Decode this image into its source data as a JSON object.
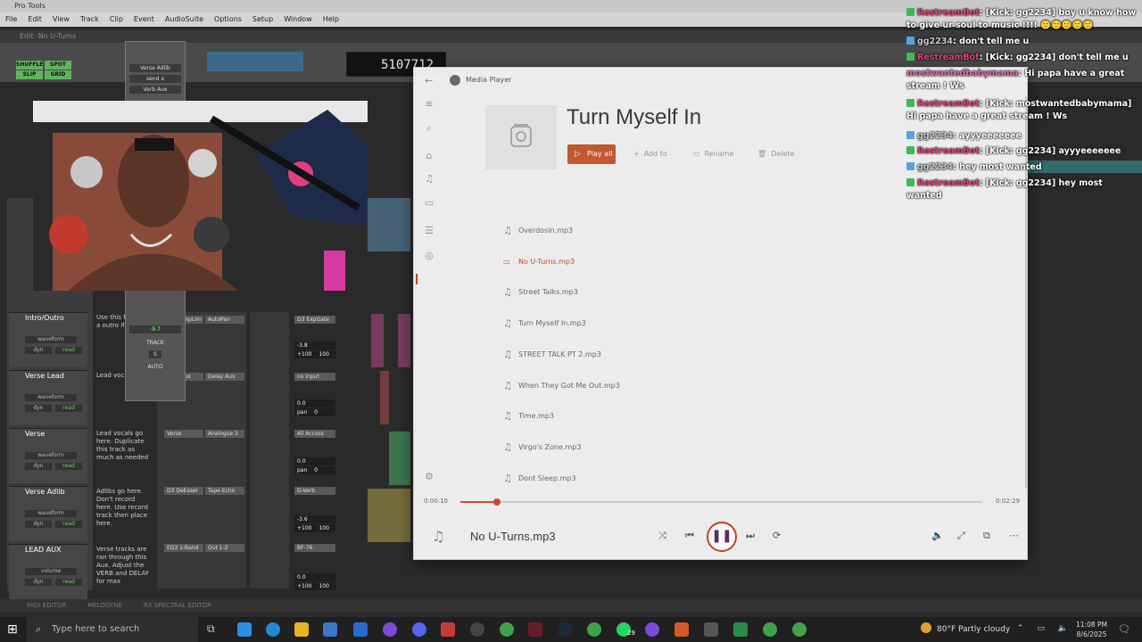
{
  "protools": {
    "title": "Pro Tools",
    "menu": [
      "File",
      "Edit",
      "View",
      "Track",
      "Clip",
      "Event",
      "AudioSuite",
      "Options",
      "Setup",
      "Window",
      "Help"
    ],
    "doc_title": "Edit: No U-Turns",
    "counter": "5107712",
    "modes": [
      "SHUFFLE",
      "SPOT",
      "SLIP",
      "GRID"
    ],
    "floating_panel": {
      "send_label": "Verse Adlib",
      "send_name": "send a",
      "aux": "Verb Aux",
      "track_label": "TRACK",
      "auto_label": "AUTO",
      "solo": "S",
      "vol": "-9.7"
    },
    "tracks": [
      {
        "name": "Intro/Outro",
        "notes": "Use this filter for a outro if n",
        "view": "waveform",
        "dyn": "dyn",
        "read": "read",
        "vol": "-3.8",
        "pan1": "+100",
        "pan2": "100"
      },
      {
        "name": "Verse Lead",
        "notes": "Lead voc here.",
        "view": "waveform",
        "dyn": "dyn",
        "read": "read",
        "vol": "0.0",
        "pan1": "pan",
        "pan2": "0"
      },
      {
        "name": "Verse",
        "notes": "Lead vocals go here. Duplicate this track as much as needed",
        "view": "waveform",
        "dyn": "dyn",
        "read": "read",
        "vol": "0.0",
        "pan1": "pan",
        "pan2": "0"
      },
      {
        "name": "Verse Adlib",
        "notes": "Adlibs go here. Don't record here. Use record track then place here.",
        "view": "waveform",
        "dyn": "dyn",
        "read": "read",
        "vol": "-3.6",
        "pan1": "+100",
        "pan2": "100"
      },
      {
        "name": "LEAD AUX",
        "notes": "Verse tracks are ran through this Aux. Adjust the VERB and DELAY for max",
        "view": "volume",
        "dyn": "dyn",
        "read": "read",
        "vol": "0.0",
        "pan1": "+100",
        "pan2": "100"
      }
    ],
    "inserts": [
      "D3 CompLim",
      "AutoPan",
      "D3 ExpGate",
      "Verb Aux",
      "Delay Aux",
      "no input",
      "Verse",
      "Analogue 2",
      "All Access",
      "D3 DeEsser",
      "Tape Echo",
      "D-Verb",
      "EQ3 1-Band",
      "Out 1-2",
      "BF-76"
    ],
    "bottom_tabs": [
      "MIDI EDITOR",
      "MELODYNE",
      "RX SPECTRAL EDITOR"
    ]
  },
  "media_player": {
    "app_title": "Media Player",
    "album_title": "Turn Myself In",
    "actions": {
      "play_all": "Play all",
      "add_to": "Add to",
      "rename": "Rename",
      "delete": "Delete"
    },
    "tracks": [
      "Overdosin.mp3",
      "No U-Turns.mp3",
      "Street Talks.mp3",
      "Turn Myself In.mp3",
      "STREET TALK PT 2.mp3",
      "When They Got Me Out.mp3",
      "Time.mp3",
      "Virgo's Zone.mp3",
      "Dont Sleep.mp3"
    ],
    "active_index": 1,
    "elapsed": "0:00:10",
    "total": "0:02:29",
    "progress_fraction": 0.07,
    "now_playing": "No U-Turns.mp3",
    "accent": "#d24a2e"
  },
  "chat": [
    {
      "icon": "check",
      "user": "RestreamBot",
      "user_class": "u-restream",
      "text": ": [Kick: gg2234] boy u know how to give ur soul to music !!!! ",
      "emotes": "🙂🙂🙂🙂🙂"
    },
    {
      "icon": "kick",
      "user": "gg2234",
      "user_class": "u-viewer",
      "text": ": don't tell me u",
      "emotes": ""
    },
    {
      "icon": "check",
      "user": "RestreamBot",
      "user_class": "u-restream",
      "text": ": [Kick: gg2234] don't tell me u",
      "emotes": ""
    },
    {
      "icon": "",
      "user": "mostwantedbabymama",
      "user_class": "u-pink",
      "text": ": Hi papa have a great stream ! Ws",
      "emotes": ""
    },
    {
      "icon": "check",
      "user": "RestreamBot",
      "user_class": "u-restream",
      "text": ": [Kick: mostwantedbabymama] Hi papa have a great stream ! Ws",
      "emotes": ""
    },
    {
      "icon": "kick",
      "user": "gg2234",
      "user_class": "u-viewer",
      "text": ": ayyyeeeeeee",
      "emotes": ""
    },
    {
      "icon": "check",
      "user": "RestreamBot",
      "user_class": "u-restream",
      "text": ": [Kick: gg2234] ayyyeeeeeee",
      "emotes": ""
    },
    {
      "icon": "kick",
      "user": "gg2234",
      "user_class": "u-viewer",
      "text": ": hey most wanted",
      "emotes": ""
    },
    {
      "icon": "check",
      "user": "RestreamBot",
      "user_class": "u-restream",
      "text": ": [Kick: gg2234] hey most wanted",
      "emotes": ""
    }
  ],
  "taskbar": {
    "search_placeholder": "Type here to search",
    "weather": "80°F  Partly cloudy",
    "time": "11:08 PM",
    "date": "8/6/2025",
    "badge": "29"
  }
}
